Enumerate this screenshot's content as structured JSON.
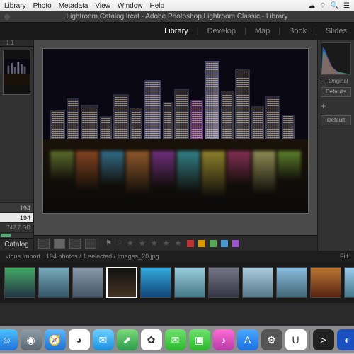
{
  "menubar": {
    "items": [
      "Library",
      "Photo",
      "Metadata",
      "View",
      "Window",
      "Help"
    ]
  },
  "window": {
    "title": "Lightroom Catalog.lrcat - Adobe Photoshop Lightroom Classic - Library"
  },
  "modules": {
    "items": [
      "Library",
      "Develop",
      "Map",
      "Book",
      "Slides"
    ],
    "active": 0
  },
  "leftpanel": {
    "counts": [
      "194",
      "194"
    ],
    "size": "742.7 GB",
    "catalog_label": "Catalog"
  },
  "rightpanel": {
    "original_label": "Original",
    "defaults_label": "Defaults",
    "default_label": "Default",
    "plus": "+"
  },
  "toolbar": {
    "stars": "★ ★ ★ ★ ★",
    "swatches": [
      "#b33",
      "#d90",
      "#5a5",
      "#49c",
      "#95c"
    ]
  },
  "statusbar": {
    "left": "vious Import",
    "center": "194 photos / 1 selected / Images_20.jpg",
    "right": "Filt"
  },
  "filmstrip": {
    "selected": 3,
    "thumbs": [
      {
        "bg": "linear-gradient(#4a6,#234)"
      },
      {
        "bg": "linear-gradient(#7ab,#356)"
      },
      {
        "bg": "linear-gradient(#89a,#456)"
      },
      {
        "bg": "linear-gradient(#111,#432)"
      },
      {
        "bg": "linear-gradient(#3ad,#147)"
      },
      {
        "bg": "linear-gradient(#9cd,#478)"
      },
      {
        "bg": "linear-gradient(#778,#334)"
      },
      {
        "bg": "linear-gradient(#acd,#578)"
      },
      {
        "bg": "linear-gradient(#8bd,#467)"
      },
      {
        "bg": "linear-gradient(#b73,#521)"
      },
      {
        "bg": "linear-gradient(#9ce,#478)"
      }
    ]
  },
  "dock": {
    "apps": [
      {
        "name": "finder",
        "bg": "linear-gradient(#4ac3ff,#1e6fd8)",
        "glyph": "☺"
      },
      {
        "name": "launchpad",
        "bg": "linear-gradient(#8d9da8,#5a6670)",
        "glyph": "◉"
      },
      {
        "name": "safari",
        "bg": "linear-gradient(#5bb8ff,#1a6fd0)",
        "glyph": "🧭"
      },
      {
        "name": "chrome",
        "bg": "#fff",
        "glyph": "◕"
      },
      {
        "name": "mail",
        "bg": "linear-gradient(#6bd0ff,#1a8fe0)",
        "glyph": "✉"
      },
      {
        "name": "maps",
        "bg": "linear-gradient(#7ad97a,#2a9d4a)",
        "glyph": "⬈"
      },
      {
        "name": "photos",
        "bg": "#fff",
        "glyph": "✿"
      },
      {
        "name": "messages",
        "bg": "linear-gradient(#6ee26e,#2ab82a)",
        "glyph": "✉"
      },
      {
        "name": "facetime",
        "bg": "linear-gradient(#6ee26e,#2ab82a)",
        "glyph": "▣"
      },
      {
        "name": "itunes",
        "bg": "linear-gradient(#ff6bd6,#b83aa8)",
        "glyph": "♪"
      },
      {
        "name": "appstore",
        "bg": "linear-gradient(#4aa8ff,#1a6fe0)",
        "glyph": "A"
      },
      {
        "name": "preferences",
        "bg": "#555",
        "glyph": "⚙"
      },
      {
        "name": "magnet",
        "bg": "#fff",
        "glyph": "U"
      },
      {
        "name": "terminal",
        "bg": "#222",
        "glyph": ">"
      },
      {
        "name": "1password",
        "bg": "#1a4fc0",
        "glyph": "◐"
      }
    ]
  }
}
